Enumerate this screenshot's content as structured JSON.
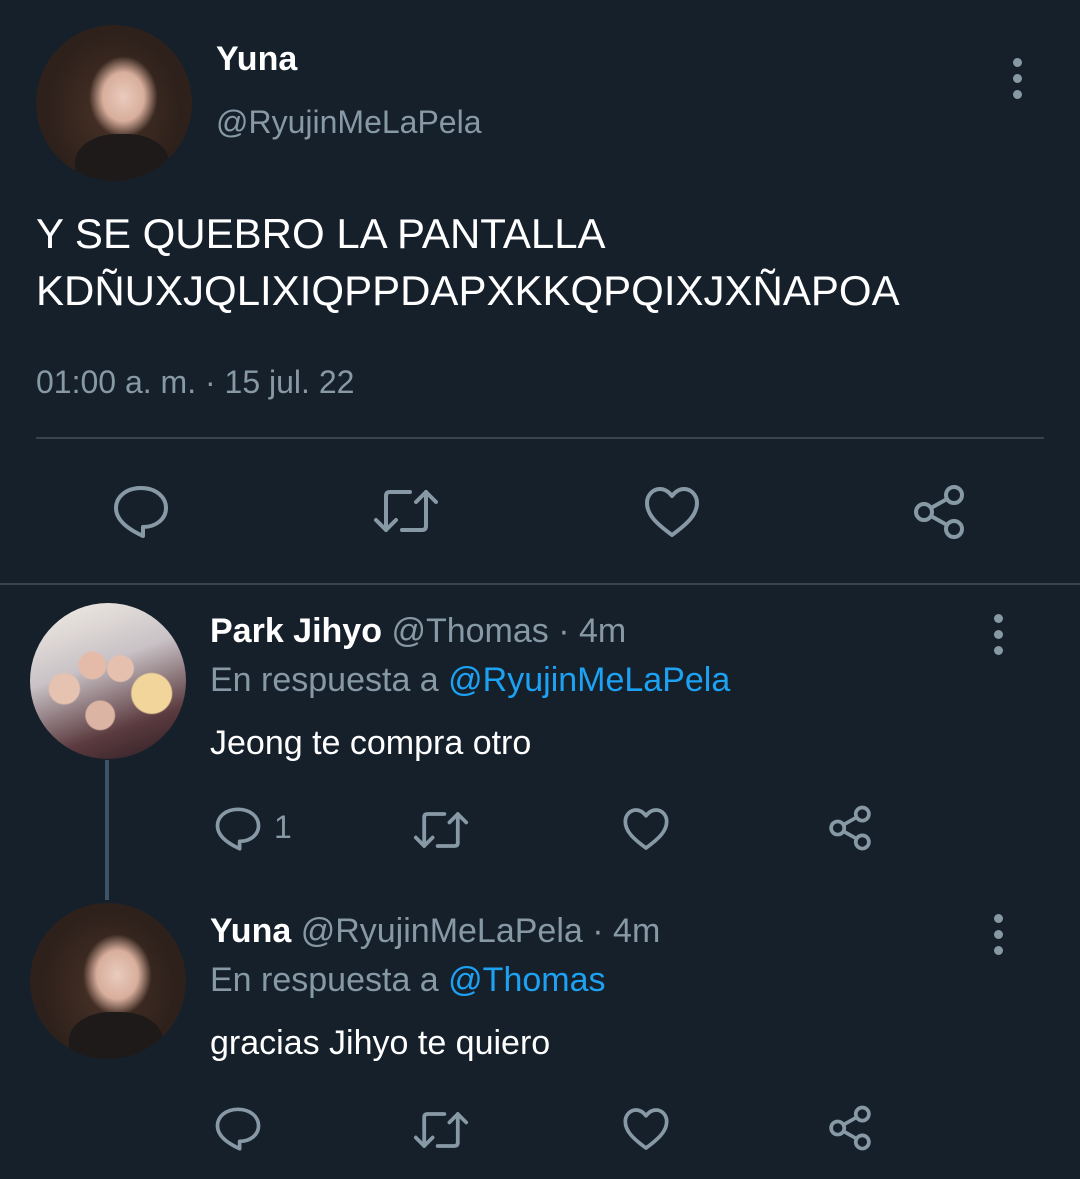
{
  "main_tweet": {
    "author_name": "Yuna",
    "author_handle": "@RyujinMeLaPela",
    "text_line1": "Y SE QUEBRO LA PANTALLA",
    "text_line2": "KDÑUXJQLIXIQPPDAPXKKQPQIXJXÑAPOA",
    "timestamp": "01:00 a. m. · 15 jul. 22",
    "actions": [
      "reply-icon",
      "retweet-icon",
      "like-icon",
      "share-icon"
    ]
  },
  "replies": [
    {
      "author_name": "Park Jihyo",
      "author_handle": "@Thomas",
      "separator": "·",
      "time": "4m",
      "reply_prefix": "En respuesta a",
      "reply_to": "@RyujinMeLaPela",
      "text": "Jeong te compra otro",
      "reply_count": "1"
    },
    {
      "author_name": "Yuna",
      "author_handle": "@RyujinMeLaPela",
      "separator": "·",
      "time": "4m",
      "reply_prefix": "En respuesta a",
      "reply_to": "@Thomas",
      "text": "gracias Jihyo te quiero",
      "reply_count": ""
    }
  ],
  "colors": {
    "background": "#15202b",
    "secondary_text": "#8899a6",
    "link": "#1da1f2",
    "divider": "#38444d"
  }
}
